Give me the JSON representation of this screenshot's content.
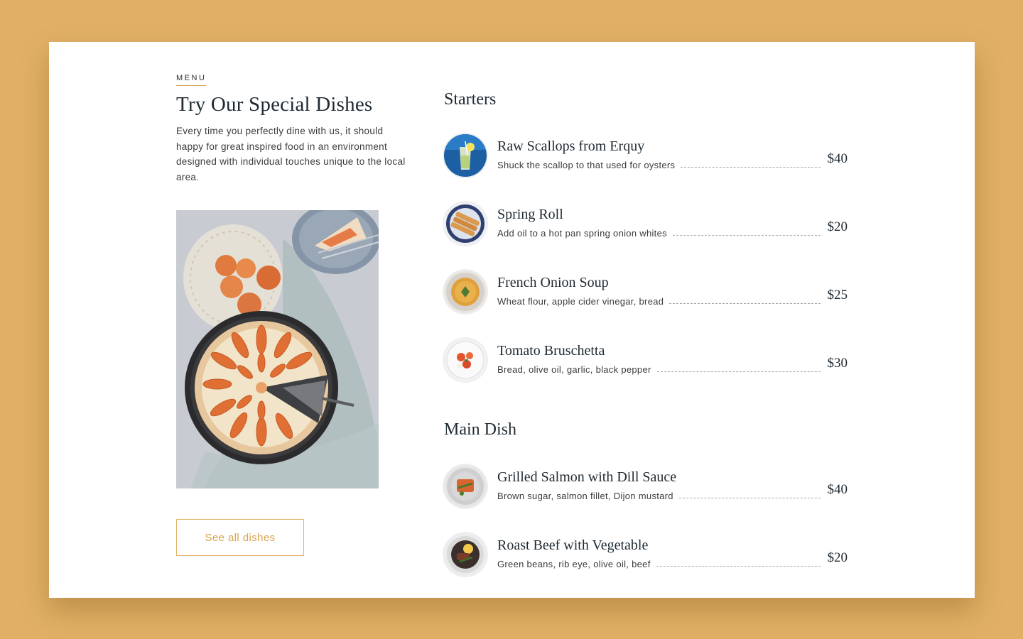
{
  "intro": {
    "eyebrow": "MENU",
    "title": "Try Our Special Dishes",
    "description": "Every time you perfectly dine with us, it should happy for great inspired food in an environment designed with individual touches unique to the local area.",
    "button_label": "See all dishes"
  },
  "sections": [
    {
      "heading": "Starters",
      "items": [
        {
          "name": "Raw Scallops from Erquy",
          "description": "Shuck the scallop to that used for oysters",
          "price": "$40",
          "icon": "cocktail-glass-icon"
        },
        {
          "name": "Spring Roll",
          "description": "Add oil to a hot pan spring onion whites",
          "price": "$20",
          "icon": "spring-roll-icon"
        },
        {
          "name": "French Onion Soup",
          "description": "Wheat flour, apple cider vinegar, bread",
          "price": "$25",
          "icon": "soup-bowl-icon"
        },
        {
          "name": "Tomato Bruschetta",
          "description": "Bread, olive oil, garlic, black pepper",
          "price": "$30",
          "icon": "bruschetta-icon"
        }
      ]
    },
    {
      "heading": "Main Dish",
      "items": [
        {
          "name": "Grilled Salmon with Dill Sauce",
          "description": "Brown sugar, salmon fillet, Dijon mustard",
          "price": "$40",
          "icon": "salmon-plate-icon"
        },
        {
          "name": "Roast Beef with Vegetable",
          "description": "Green beans, rib eye, olive oil, beef",
          "price": "$20",
          "icon": "roast-beef-plate-icon"
        }
      ]
    }
  ],
  "colors": {
    "page_background": "#e1b066",
    "accent": "#d9a550",
    "heading_text": "#1f2a32",
    "body_text": "#3b3b3b"
  }
}
